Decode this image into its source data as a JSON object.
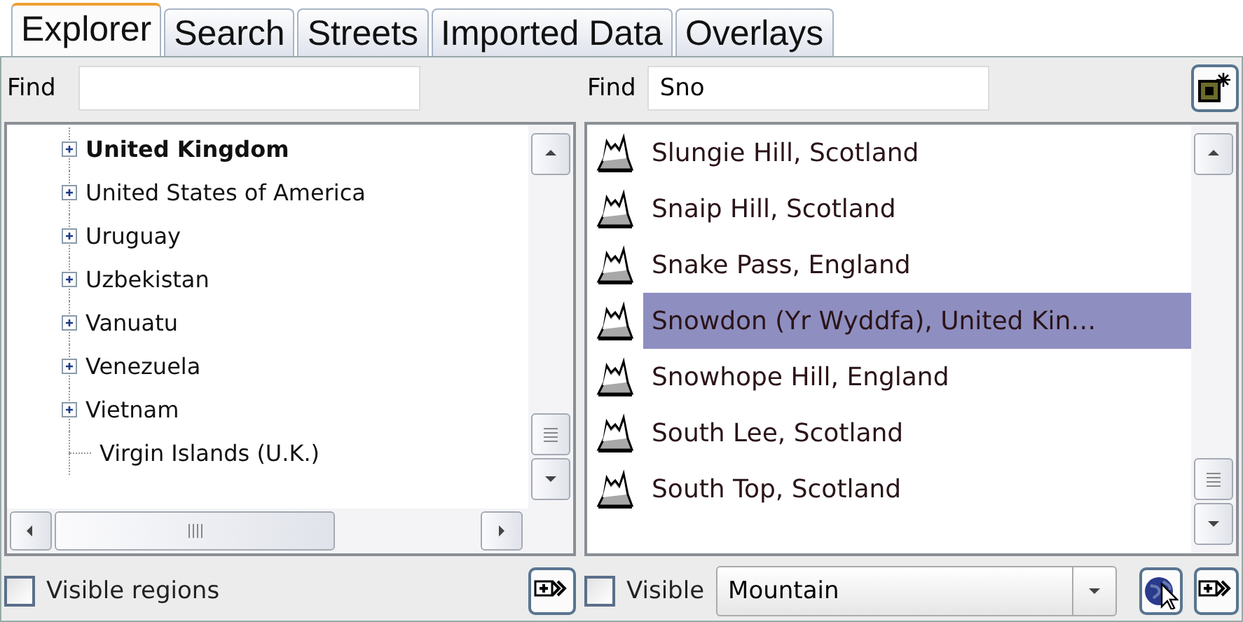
{
  "tabs": [
    {
      "label": "Explorer",
      "selected": true
    },
    {
      "label": "Search",
      "selected": false
    },
    {
      "label": "Streets",
      "selected": false
    },
    {
      "label": "Imported Data",
      "selected": false
    },
    {
      "label": "Overlays",
      "selected": false
    }
  ],
  "regions_panel": {
    "find_label": "Find",
    "tree": [
      {
        "label": "United Kingdom",
        "expandable": true,
        "bold": true
      },
      {
        "label": "United States of America",
        "expandable": true,
        "bold": false
      },
      {
        "label": "Uruguay",
        "expandable": true,
        "bold": false
      },
      {
        "label": "Uzbekistan",
        "expandable": true,
        "bold": false
      },
      {
        "label": "Vanuatu",
        "expandable": true,
        "bold": false
      },
      {
        "label": "Venezuela",
        "expandable": true,
        "bold": false
      },
      {
        "label": "Vietnam",
        "expandable": true,
        "bold": false
      },
      {
        "label": "Virgin Islands (U.K.)",
        "expandable": false,
        "bold": false
      }
    ],
    "visible_checkbox": {
      "label": "Visible regions",
      "checked": false
    }
  },
  "places_panel": {
    "find_label": "Find",
    "find_value": "Sno",
    "results": [
      {
        "label": "Slungie Hill, Scotland",
        "selected": false
      },
      {
        "label": "Snaip Hill, Scotland",
        "selected": false
      },
      {
        "label": "Snake Pass, England",
        "selected": false
      },
      {
        "label": "Snowdon (Yr Wyddfa), United Kin…",
        "selected": true
      },
      {
        "label": "Snowhope Hill, England",
        "selected": false
      },
      {
        "label": "South Lee, Scotland",
        "selected": false
      },
      {
        "label": "South Top, Scotland",
        "selected": false
      }
    ],
    "visible_checkbox": {
      "label": "Visible",
      "checked": false
    },
    "type_dropdown": {
      "value": "Mountain"
    }
  }
}
